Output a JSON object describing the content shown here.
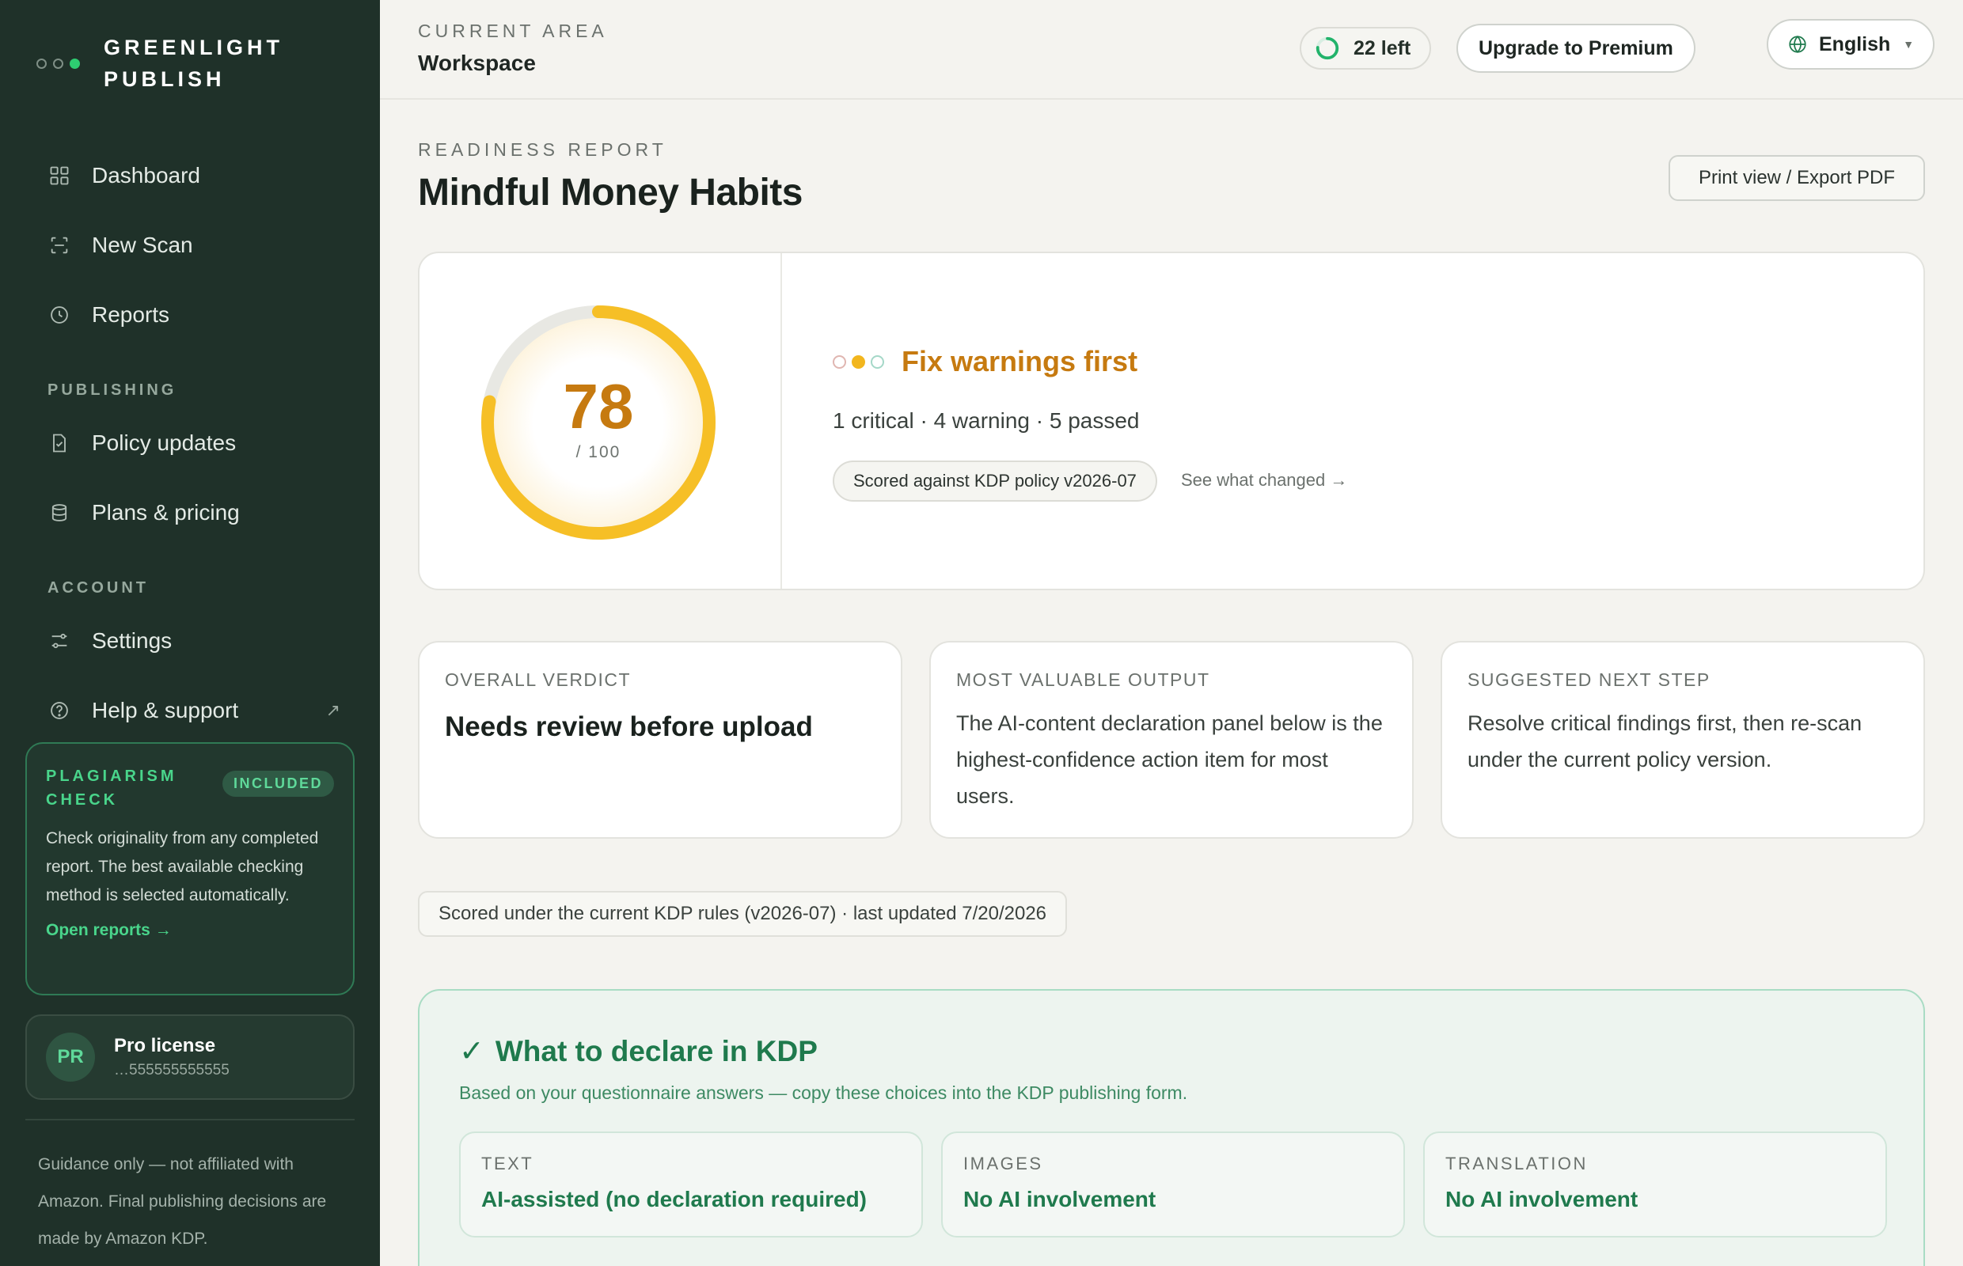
{
  "brand": {
    "name": "GREENLIGHT PUBLISH"
  },
  "sidebar": {
    "nav": [
      {
        "label": "Dashboard",
        "icon": "grid-icon"
      },
      {
        "label": "New Scan",
        "icon": "scan-icon"
      },
      {
        "label": "Reports",
        "icon": "clock-icon"
      }
    ],
    "publishing_label": "PUBLISHING",
    "publishing": [
      {
        "label": "Policy updates",
        "icon": "document-check-icon"
      },
      {
        "label": "Plans & pricing",
        "icon": "database-icon"
      }
    ],
    "account_label": "ACCOUNT",
    "account": [
      {
        "label": "Settings",
        "icon": "sliders-icon"
      },
      {
        "label": "Help & support",
        "icon": "help-circle-icon",
        "external": "↗"
      }
    ],
    "plagiarism": {
      "title": "PLAGIARISM CHECK",
      "badge": "INCLUDED",
      "text": "Check originality from any completed report. The best available checking method is selected automatically.",
      "link": "Open reports →"
    },
    "license": {
      "initials": "PR",
      "name": "Pro license",
      "key": "…555555555555"
    },
    "footer": "Guidance only — not affiliated with Amazon. Final publishing decisions are made by Amazon KDP."
  },
  "header": {
    "area_label": "CURRENT AREA",
    "area_value": "Workspace",
    "credits": "22 left",
    "upgrade": "Upgrade to Premium",
    "language": "English"
  },
  "report": {
    "eyebrow": "READINESS REPORT",
    "title": "Mindful Money Habits",
    "print_button": "Print view / Export PDF",
    "score": 78,
    "score_max": "/ 100",
    "score_fraction": 0.78,
    "status_title": "Fix warnings first",
    "counts": "1 critical · 4 warning · 5 passed",
    "policy_chip": "Scored against KDP policy v2026-07",
    "changed_link": "See what changed →"
  },
  "cards": [
    {
      "label": "OVERALL VERDICT",
      "text": "Needs review before upload"
    },
    {
      "label": "MOST VALUABLE OUTPUT",
      "text": "The AI-content declaration panel below is the highest-confidence action item for most users."
    },
    {
      "label": "SUGGESTED NEXT STEP",
      "text": "Resolve critical findings first, then re-scan under the current policy version."
    }
  ],
  "rules_note": "Scored under the current KDP rules (v2026-07) · last updated 7/20/2026",
  "declare": {
    "check": "✓",
    "title": "What to declare in KDP",
    "subtitle": "Based on your questionnaire answers — copy these choices into the KDP publishing form.",
    "items": [
      {
        "label": "TEXT",
        "value": "AI-assisted (no declaration required)"
      },
      {
        "label": "IMAGES",
        "value": "No AI involvement"
      },
      {
        "label": "TRANSLATION",
        "value": "No AI involvement"
      }
    ]
  },
  "colors": {
    "sidebar_bg": "#1f3129",
    "accent_green": "#1f7a4d",
    "accent_amber": "#c67a10",
    "ring_yellow": "#f6bf26"
  }
}
